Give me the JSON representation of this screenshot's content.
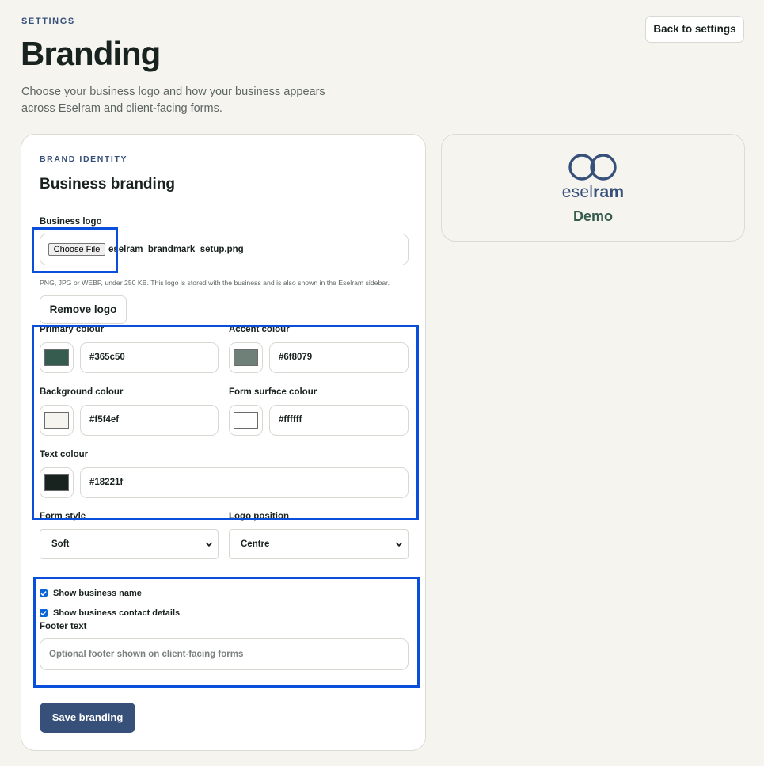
{
  "page": {
    "eyebrow": "SETTINGS",
    "title": "Branding",
    "subtitle": "Choose your business logo and how your business appears across Eselram and client-facing forms.",
    "back_label": "Back to settings"
  },
  "card": {
    "eyebrow": "BRAND IDENTITY",
    "title": "Business branding",
    "logo": {
      "label": "Business logo",
      "choose_label": "Choose File",
      "filename": "eselram_brandmark_setup.png",
      "hint": "PNG, JPG or WEBP, under 250 KB. This logo is stored with the business and is also shown in the Eselram sidebar.",
      "remove_label": "Remove logo"
    },
    "colours": {
      "primary": {
        "label": "Primary colour",
        "value": "#365c50"
      },
      "accent": {
        "label": "Accent colour",
        "value": "#6f8079"
      },
      "background": {
        "label": "Background colour",
        "value": "#f5f4ef"
      },
      "surface": {
        "label": "Form surface colour",
        "value": "#ffffff"
      },
      "text": {
        "label": "Text colour",
        "value": "#18221f"
      }
    },
    "form_style": {
      "label": "Form style",
      "value": "Soft"
    },
    "logo_position": {
      "label": "Logo position",
      "value": "Centre"
    },
    "show_name": {
      "label": "Show business name",
      "checked": true
    },
    "show_contact": {
      "label": "Show business contact details",
      "checked": true
    },
    "footer": {
      "label": "Footer text",
      "placeholder": "Optional footer shown on client-facing forms"
    },
    "save_label": "Save branding"
  },
  "preview": {
    "brand_light": "esel",
    "brand_bold": "ram",
    "business_name": "Demo"
  },
  "colors": {
    "accent": "#36507a",
    "highlight": "#0a4fdc",
    "checkbox": "#0a66d6"
  }
}
